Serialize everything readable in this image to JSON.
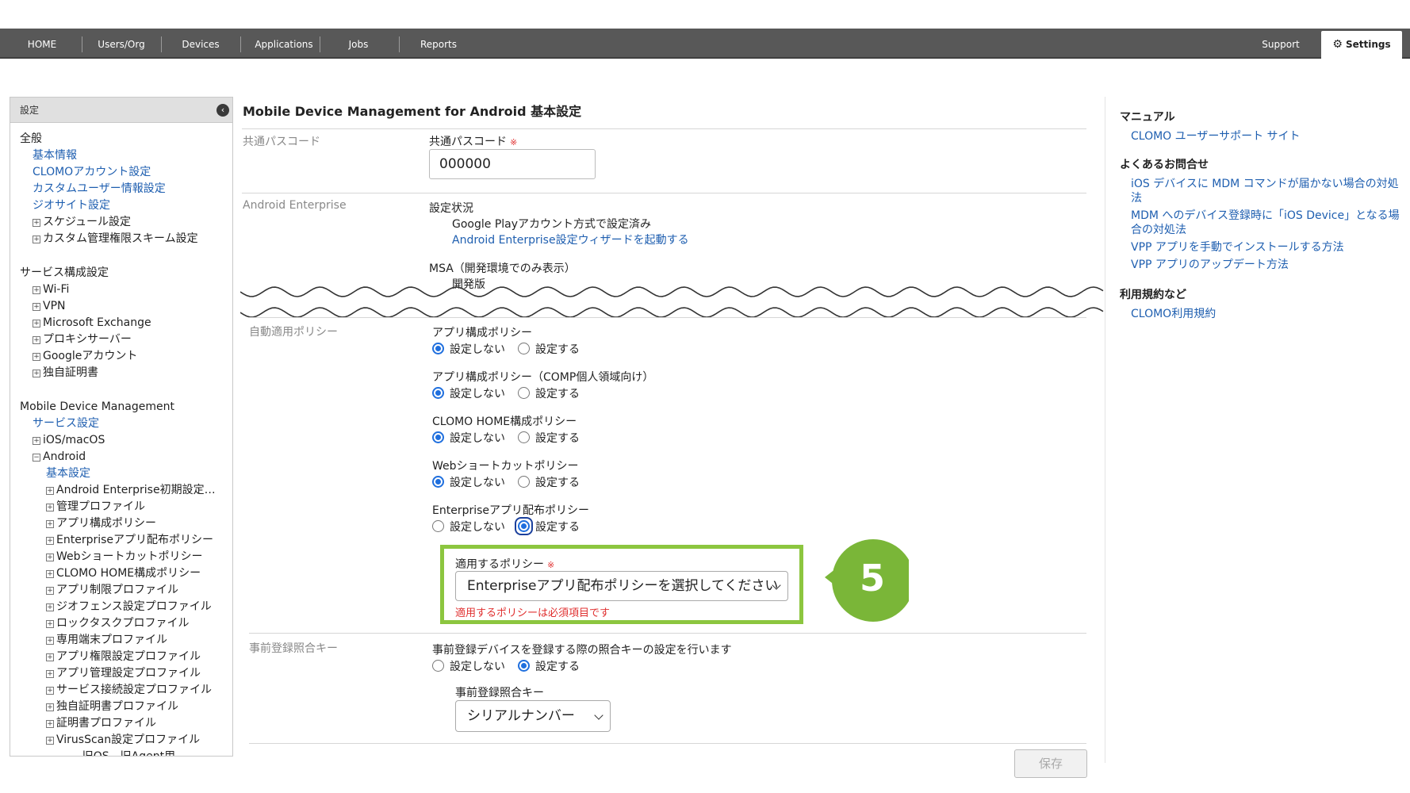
{
  "nav": {
    "items": [
      "HOME",
      "Users/Org",
      "Devices",
      "Applications",
      "Jobs",
      "Reports"
    ],
    "support": "Support",
    "settings": "Settings"
  },
  "sidebar": {
    "header": "設定",
    "general": {
      "title": "全般",
      "links": [
        "基本情報",
        "CLOMOアカウント設定",
        "カスタムユーザー情報設定",
        "ジオサイト設定"
      ],
      "expandables": [
        "スケジュール設定",
        "カスタム管理権限スキーム設定"
      ]
    },
    "service": {
      "title": "サービス構成設定",
      "items": [
        "Wi-Fi",
        "VPN",
        "Microsoft Exchange",
        "プロキシサーバー",
        "Googleアカウント",
        "独自証明書"
      ]
    },
    "mdm": {
      "title": "Mobile Device Management",
      "service_link": "サービス設定",
      "ios": "iOS/macOS",
      "android": "Android",
      "android_basic": "基本設定",
      "android_items": [
        "Android Enterprise初期設定…",
        "管理プロファイル",
        "アプリ構成ポリシー",
        "Enterpriseアプリ配布ポリシー",
        "Webショートカットポリシー",
        "CLOMO HOME構成ポリシー",
        "アプリ制限プロファイル",
        "ジオフェンス設定プロファイル",
        "ロックタスクプロファイル",
        "専用端末プロファイル",
        "アプリ権限設定プロファイル",
        "アプリ管理設定プロファイル",
        "サービス接続設定プロファイル",
        "独自証明書プロファイル",
        "証明書プロファイル",
        "VirusScan設定プロファイル"
      ],
      "legacy": "----- 旧OS、旧Agent用 -----"
    }
  },
  "main": {
    "title": "Mobile Device Management for Android 基本設定",
    "passcode": {
      "row_label": "共通パスコード",
      "field_label": "共通パスコード",
      "required_mark": "※",
      "value": "000000"
    },
    "android_enterprise": {
      "row_label": "Android Enterprise",
      "status_label": "設定状況",
      "status_value": "Google Playアカウント方式で設定済み",
      "wizard_link": "Android Enterprise設定ウィザードを起動する",
      "msa_label": "MSA（開発環境でのみ表示）",
      "msa_value": "開発版"
    },
    "auto_policy": {
      "row_label": "自動適用ポリシー",
      "groups": [
        {
          "label": "アプリ構成ポリシー",
          "selected": "off"
        },
        {
          "label": "アプリ構成ポリシー（COMP個人領域向け）",
          "selected": "off"
        },
        {
          "label": "CLOMO HOME構成ポリシー",
          "selected": "off"
        },
        {
          "label": "Webショートカットポリシー",
          "selected": "off"
        },
        {
          "label": "Enterpriseアプリ配布ポリシー",
          "selected": "on"
        }
      ],
      "opt_off": "設定しない",
      "opt_on": "設定する",
      "apply_policy_label": "適用するポリシー",
      "required_mark": "※",
      "select_value": "Enterpriseアプリ配布ポリシーを選択してください",
      "error": "適用するポリシーは必須項目です"
    },
    "prereg": {
      "row_label": "事前登録照合キー",
      "description": "事前登録デバイスを登録する際の照合キーの設定を行います",
      "selected": "on",
      "key_label": "事前登録照合キー",
      "key_value": "シリアルナンバー"
    },
    "save": "保存",
    "step_badge": "5",
    "badge_color": "#7ab638"
  },
  "rightpanel": {
    "manual_title": "マニュアル",
    "manual_link": "CLOMO ユーザーサポート サイト",
    "faq_title": "よくあるお問合せ",
    "faq_links": [
      "iOS デバイスに MDM コマンドが届かない場合の対処法",
      "MDM へのデバイス登録時に「iOS Device」となる場合の対処法",
      "VPP アプリを手動でインストールする方法",
      "VPP アプリのアップデート方法"
    ],
    "terms_title": "利用規約など",
    "terms_link": "CLOMO利用規約"
  }
}
